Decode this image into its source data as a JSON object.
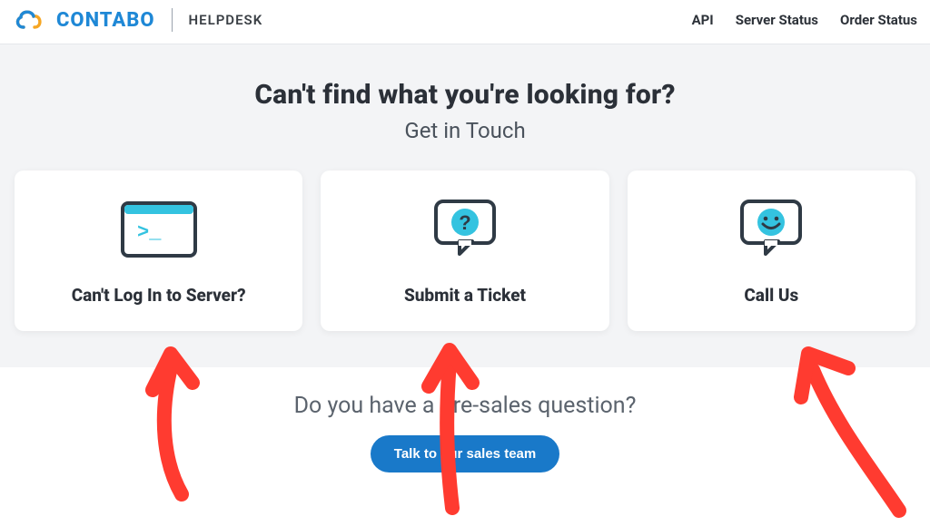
{
  "brand": {
    "name": "CONTABO",
    "section": "HELPDESK"
  },
  "nav": {
    "api": "API",
    "server_status": "Server Status",
    "order_status": "Order Status"
  },
  "hero": {
    "title": "Can't find what you're looking for?",
    "subtitle": "Get in Touch"
  },
  "cards": {
    "login": "Can't Log In to Server?",
    "ticket": "Submit a Ticket",
    "call": "Call Us"
  },
  "presales": {
    "question": "Do you have a pre-sales question?",
    "cta": "Talk to our sales team"
  }
}
